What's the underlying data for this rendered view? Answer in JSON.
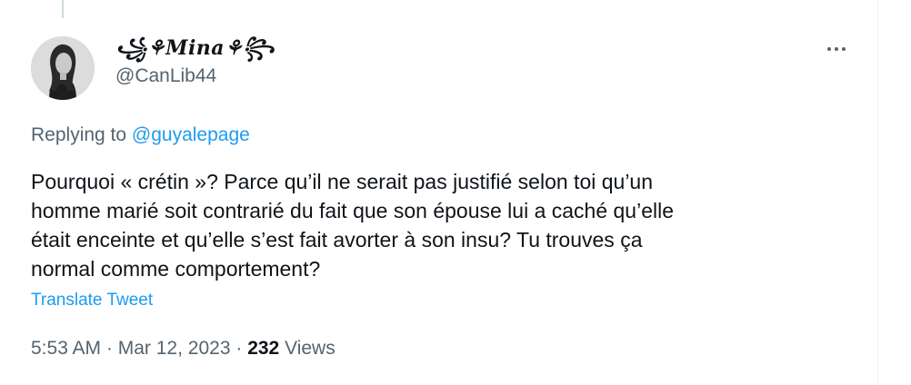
{
  "tweet": {
    "display_name": "꧁⚘Mina⚘꧂",
    "username": "@CanLib44",
    "replying_prefix": "Replying to",
    "replying_to": "@guyalepage",
    "text_lines": [
      "Pourquoi « crétin »? Parce qu’il ne serait pas justifié selon toi qu’un",
      "homme marié soit contrarié du fait que son épouse lui a caché qu’elle",
      "était enceinte et qu’elle s’est fait avorter à son insu? Tu trouves ça",
      "normal comme comportement?"
    ],
    "translate_label": "Translate Tweet",
    "time": "5:53 AM",
    "separator": "·",
    "date": "Mar 12, 2023",
    "views_count": "232",
    "views_label": "Views"
  },
  "icons": {
    "more": "more-dots-icon",
    "avatar": "profile-photo"
  },
  "colors": {
    "text": "#0f1419",
    "secondary": "#536471",
    "link": "#1d9bf0",
    "border": "#eff3f4"
  }
}
